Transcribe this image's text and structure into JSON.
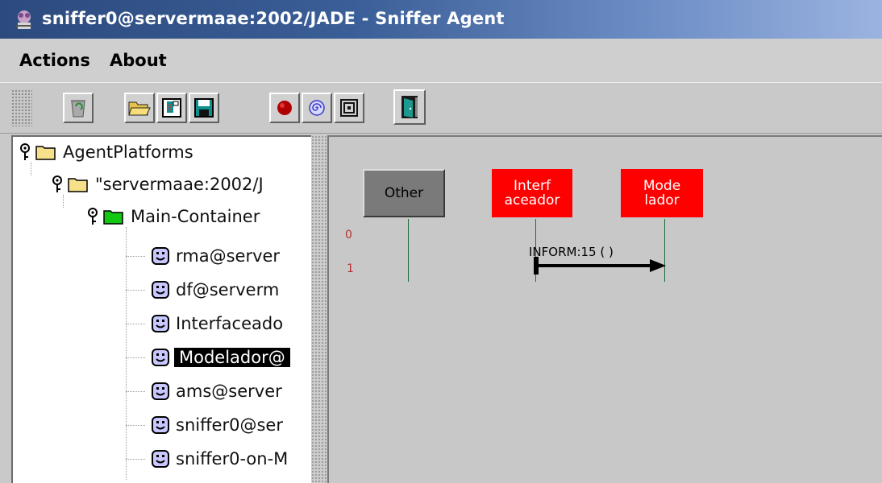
{
  "window": {
    "title": "sniffer0@servermaae:2002/JADE - Sniffer Agent"
  },
  "menu": {
    "items": [
      {
        "label": "Actions"
      },
      {
        "label": "About"
      }
    ]
  },
  "toolbar": {
    "buttons": [
      {
        "icon": "trash-icon"
      },
      {
        "icon": "open-folder-icon"
      },
      {
        "icon": "document-icon"
      },
      {
        "icon": "save-icon"
      },
      {
        "icon": "record-icon"
      },
      {
        "icon": "spiral-icon"
      },
      {
        "icon": "target-square-icon"
      },
      {
        "icon": "exit-door-icon"
      }
    ]
  },
  "tree": {
    "root": {
      "label": "AgentPlatforms"
    },
    "platform": {
      "label": "\"servermaae:2002/J"
    },
    "container": {
      "label": "Main-Container"
    },
    "agents": [
      {
        "label": "rma@server"
      },
      {
        "label": "df@serverm"
      },
      {
        "label": "Interfaceado"
      },
      {
        "label": "Modelador@",
        "selected": true
      },
      {
        "label": "ams@server"
      },
      {
        "label": "sniffer0@ser"
      },
      {
        "label": "sniffer0-on-M"
      }
    ]
  },
  "canvas": {
    "agents": [
      {
        "label": "Other",
        "color": "#7a7a7a",
        "text_color": "#000000"
      },
      {
        "label": "Interf\naceador",
        "color": "#ff0000",
        "text_color": "#ffffff"
      },
      {
        "label": "Mode\nlador",
        "color": "#ff0000",
        "text_color": "#ffffff"
      }
    ],
    "row_numbers": [
      "0",
      "1"
    ],
    "message": {
      "label": "INFORM:15 (     )",
      "from": "Interf aceador",
      "to": "Mode lador"
    }
  },
  "colors": {
    "selection": "#000000",
    "agent_red": "#ff0000",
    "agent_gray": "#7a7a7a",
    "lifeline": "#1f6b3a",
    "row_number": "#b03030"
  }
}
